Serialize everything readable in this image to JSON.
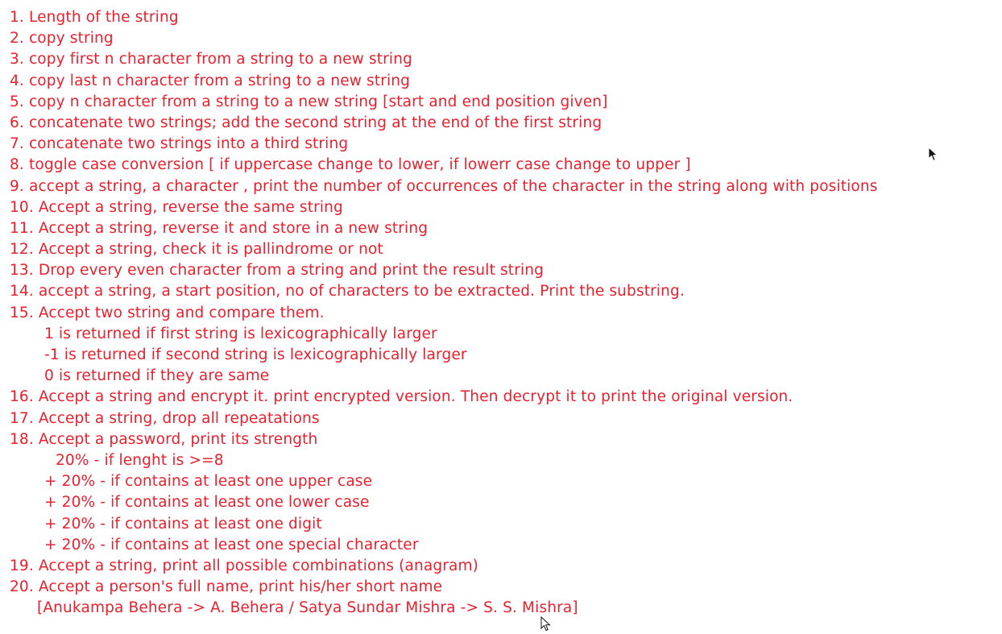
{
  "lines": [
    {
      "text": "1. Length of the string",
      "indent": 0
    },
    {
      "text": "2. copy string",
      "indent": 0
    },
    {
      "text": "3. copy first n character from a string to a new string",
      "indent": 0
    },
    {
      "text": "4. copy last n character from a string to a new string",
      "indent": 0
    },
    {
      "text": "5. copy n character from a string to a new string [start and end position given]",
      "indent": 0
    },
    {
      "text": "6. concatenate two strings; add the second string at the end of the first string",
      "indent": 0
    },
    {
      "text": "7. concatenate two strings into a third string",
      "indent": 0
    },
    {
      "text": "8. toggle case conversion [ if uppercase change to lower, if lowerr case change to upper ]",
      "indent": 0
    },
    {
      "text": "9. accept a string, a character , print the number of occurrences of the character in the string along with positions",
      "indent": 0
    },
    {
      "text": "10. Accept a string, reverse the same string",
      "indent": 0
    },
    {
      "text": "11. Accept a string, reverse it and store in a new string",
      "indent": 0
    },
    {
      "text": "12. Accept a string, check it is pallindrome or not",
      "indent": 0
    },
    {
      "text": "13. Drop every even character from a string and print the result string",
      "indent": 0
    },
    {
      "text": "14. accept a string, a start position, no of characters to be extracted. Print the substring.",
      "indent": 0
    },
    {
      "text": "15. Accept two string and compare them.",
      "indent": 0
    },
    {
      "text": "1 is returned if first string is lexicographically larger",
      "indent": 1
    },
    {
      "text": "-1 is returned if second string is lexicographically larger",
      "indent": 1
    },
    {
      "text": "0 is returned if they are same",
      "indent": 1
    },
    {
      "text": "16. Accept a string and encrypt it. print encrypted version. Then decrypt it to print the original version.",
      "indent": 0
    },
    {
      "text": "17. Accept a string, drop all repeatations",
      "indent": 0
    },
    {
      "text": "18. Accept a password, print its strength",
      "indent": 0
    },
    {
      "text": "20% - if lenght is >=8",
      "indent": 2
    },
    {
      "text": "+ 20% - if contains at least one upper case",
      "indent": 3
    },
    {
      "text": "+ 20% - if contains at least one lower case",
      "indent": 3
    },
    {
      "text": "+ 20% - if contains at least one digit",
      "indent": 3
    },
    {
      "text": "+ 20% - if contains at least one special character",
      "indent": 3
    },
    {
      "text": "19. Accept a string, print all possible combinations (anagram)",
      "indent": 0
    },
    {
      "text": "20. Accept a person's full name, print his/her short name",
      "indent": 0
    },
    {
      "text": "[Anukampa Behera -> A. Behera / Satya Sundar Mishra -> S. S. Mishra]",
      "indent": 4
    }
  ],
  "style": {
    "text_color": "#e8212f",
    "background": "#ffffff"
  },
  "icons": {
    "cursor": "mouse-pointer-icon"
  }
}
